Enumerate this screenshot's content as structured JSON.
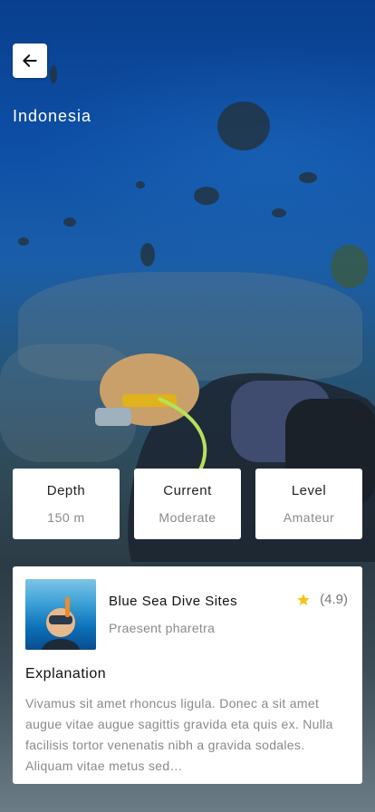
{
  "header": {
    "location": "Indonesia",
    "back_icon": "arrow-left-icon"
  },
  "stats": [
    {
      "label": "Depth",
      "value": "150 m"
    },
    {
      "label": "Current",
      "value": "Moderate"
    },
    {
      "label": "Level",
      "value": "Amateur"
    }
  ],
  "site": {
    "name": "Blue Sea Dive Sites",
    "subtitle": "Praesent pharetra",
    "rating": "(4.9)",
    "rating_icon": "star-icon",
    "star_color": "#f5c518"
  },
  "explanation": {
    "title": "Explanation",
    "text": "Vivamus sit amet rhoncus ligula. Donec a sit amet augue vitae augue sagittis gravida eta quis ex. Nulla facilisis tortor venenatis nibh a gravida sodales. Aliquam vitae metus sed…"
  }
}
